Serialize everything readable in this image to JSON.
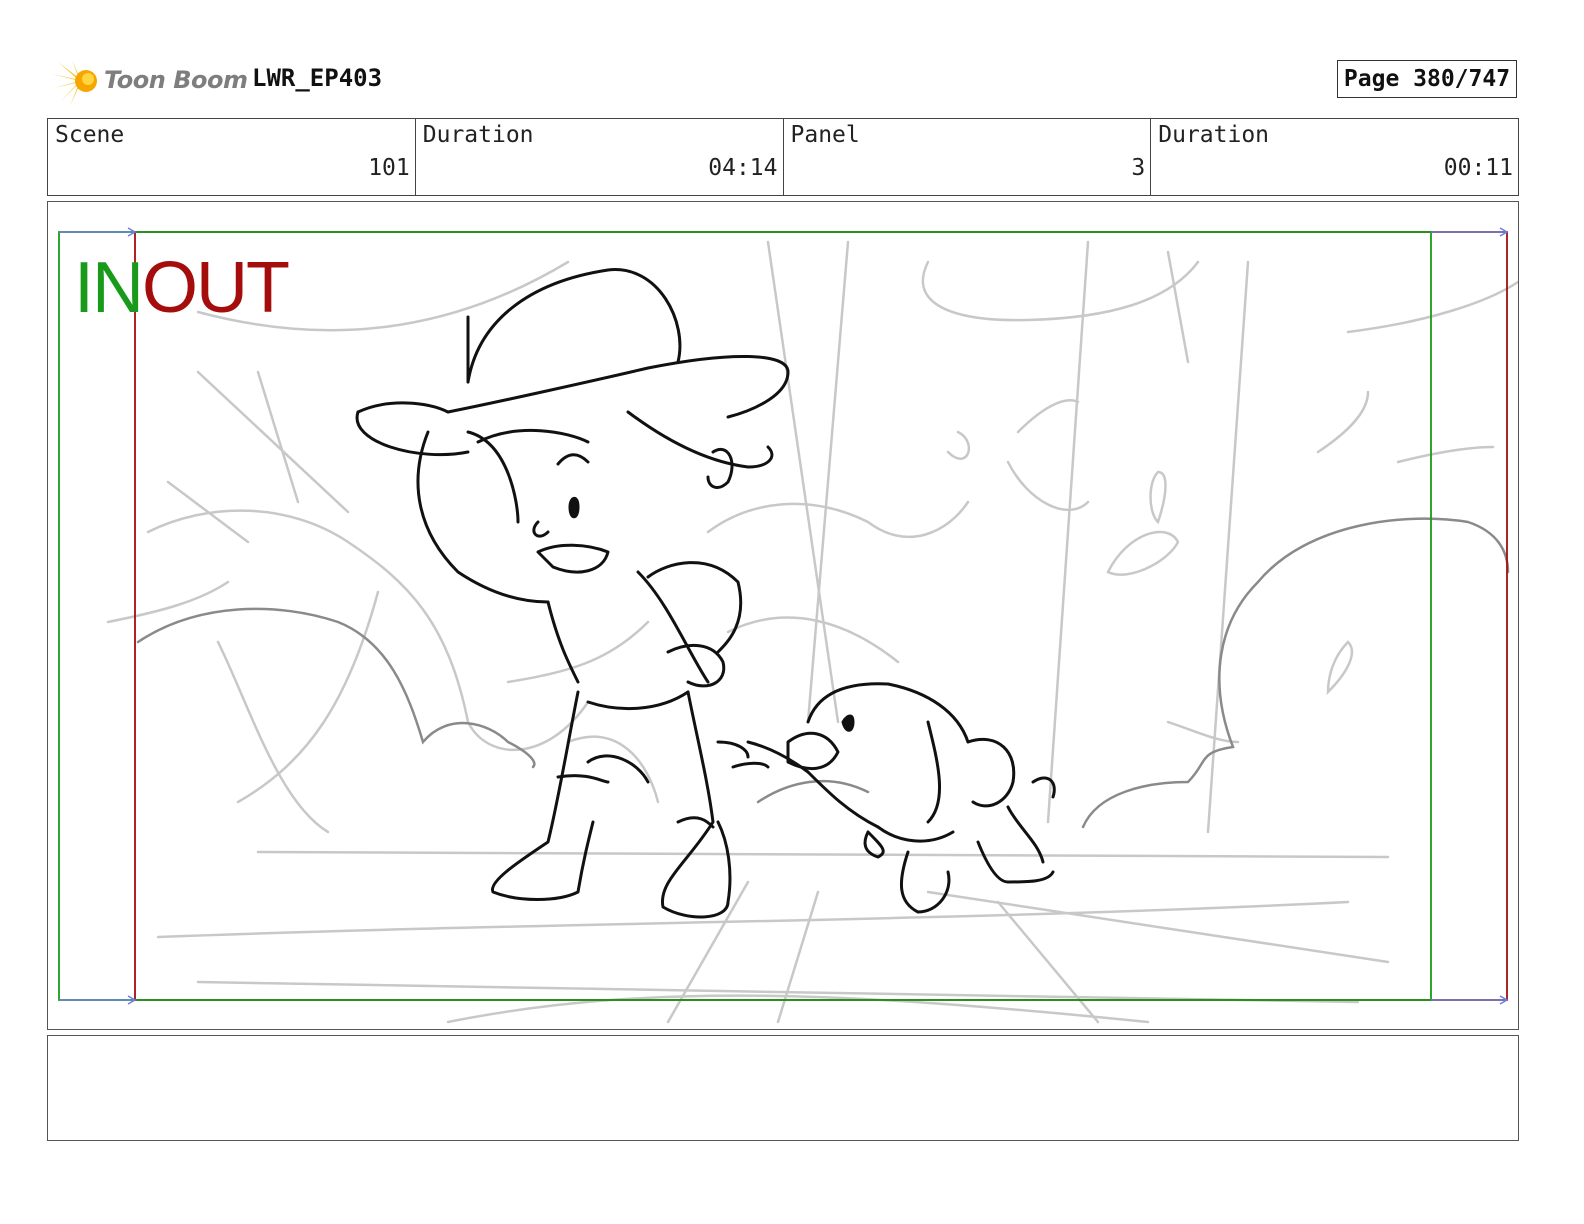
{
  "header": {
    "logo_text": "Toon Boom",
    "project": "LWR_EP403",
    "page": "Page 380/747"
  },
  "info": {
    "scene_label": "Scene",
    "scene_value": "101",
    "scene_duration_label": "Duration",
    "scene_duration_value": "04:14",
    "panel_label": "Panel",
    "panel_value": "3",
    "panel_duration_label": "Duration",
    "panel_duration_value": "00:11"
  },
  "panel": {
    "in_label": "IN",
    "out_label": "OUT",
    "colors": {
      "in_frame": "#1a9a1a",
      "out_frame": "#a50d0d",
      "guide_arrow": "#6a7fd6",
      "sketch_line": "#111111",
      "background_sketch": "#c8c8c8"
    }
  },
  "notes": {
    "text": ""
  }
}
